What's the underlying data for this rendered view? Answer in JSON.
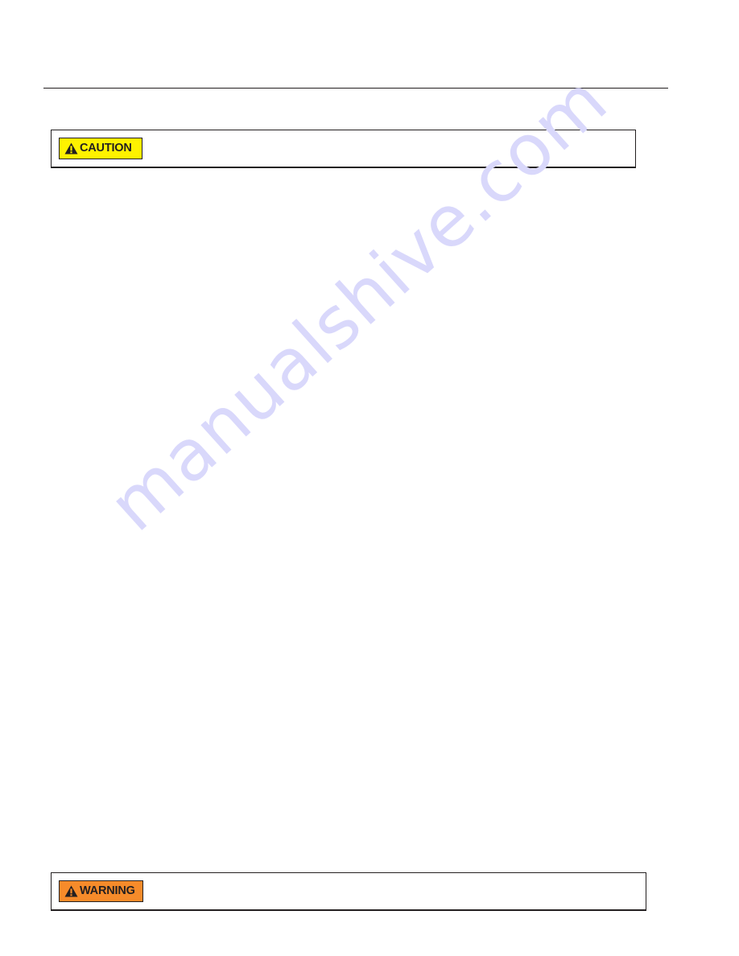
{
  "page": {
    "watermark": "manualshive.com"
  },
  "notices": {
    "caution": {
      "label": "CAUTION",
      "icon": "warning-triangle-icon",
      "color": "#fff200",
      "text_color": "#231f20"
    },
    "warning": {
      "label": "WARNING",
      "icon": "warning-triangle-icon",
      "color": "#f68b2a",
      "text_color": "#231f20"
    }
  }
}
